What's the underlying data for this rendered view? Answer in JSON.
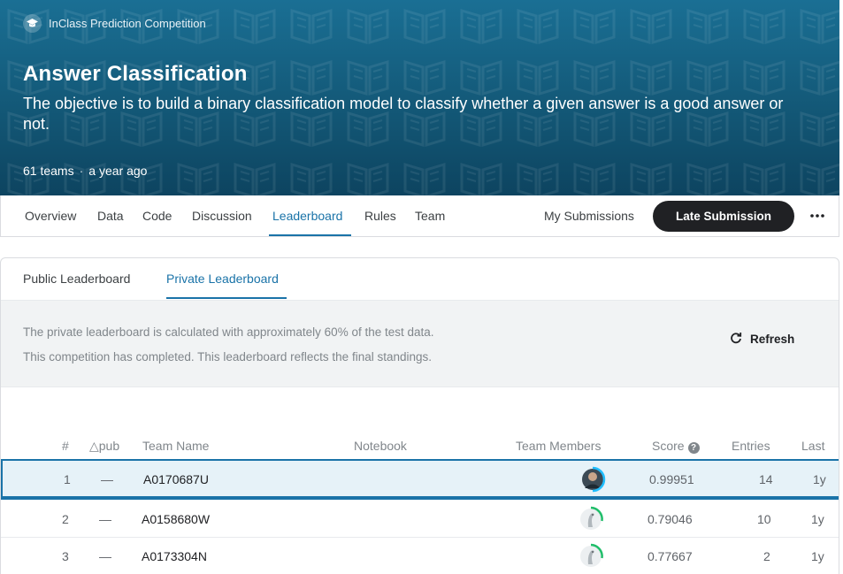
{
  "header": {
    "competition_type": "InClass Prediction Competition",
    "title": "Answer Classification",
    "subtitle": "The objective is to build a binary classification model to classify whether a given answer is a good answer or not.",
    "teams": "61 teams",
    "separator": "·",
    "age": "a year ago"
  },
  "nav": {
    "tabs": [
      "Overview",
      "Data",
      "Code",
      "Discussion",
      "Leaderboard",
      "Rules",
      "Team"
    ],
    "active_tab": "Leaderboard",
    "my_submissions": "My Submissions",
    "late_submission": "Late Submission",
    "more_icon": "more-horizontal-icon"
  },
  "leaderboard": {
    "subtabs": [
      "Public Leaderboard",
      "Private Leaderboard"
    ],
    "active_subtab": "Private Leaderboard",
    "info_line1": "The private leaderboard is calculated with approximately 60% of the test data.",
    "info_line2": "This competition has completed. This leaderboard reflects the final standings.",
    "refresh_label": "Refresh",
    "columns": {
      "rank": "#",
      "delta": "△pub",
      "team_name": "Team Name",
      "notebook": "Notebook",
      "members": "Team Members",
      "score": "Score",
      "entries": "Entries",
      "last": "Last"
    },
    "rows": [
      {
        "rank": "1",
        "delta": "—",
        "team": "A0170687U",
        "score": "0.99951",
        "entries": "14",
        "last": "1y",
        "highlight": true
      },
      {
        "rank": "2",
        "delta": "—",
        "team": "A0158680W",
        "score": "0.79046",
        "entries": "10",
        "last": "1y",
        "highlight": false
      },
      {
        "rank": "3",
        "delta": "—",
        "team": "A0173304N",
        "score": "0.77667",
        "entries": "2",
        "last": "1y",
        "highlight": false
      }
    ]
  },
  "colors": {
    "banner": "#135877",
    "accent": "#1a73a8",
    "progress_green": "#20beff"
  }
}
